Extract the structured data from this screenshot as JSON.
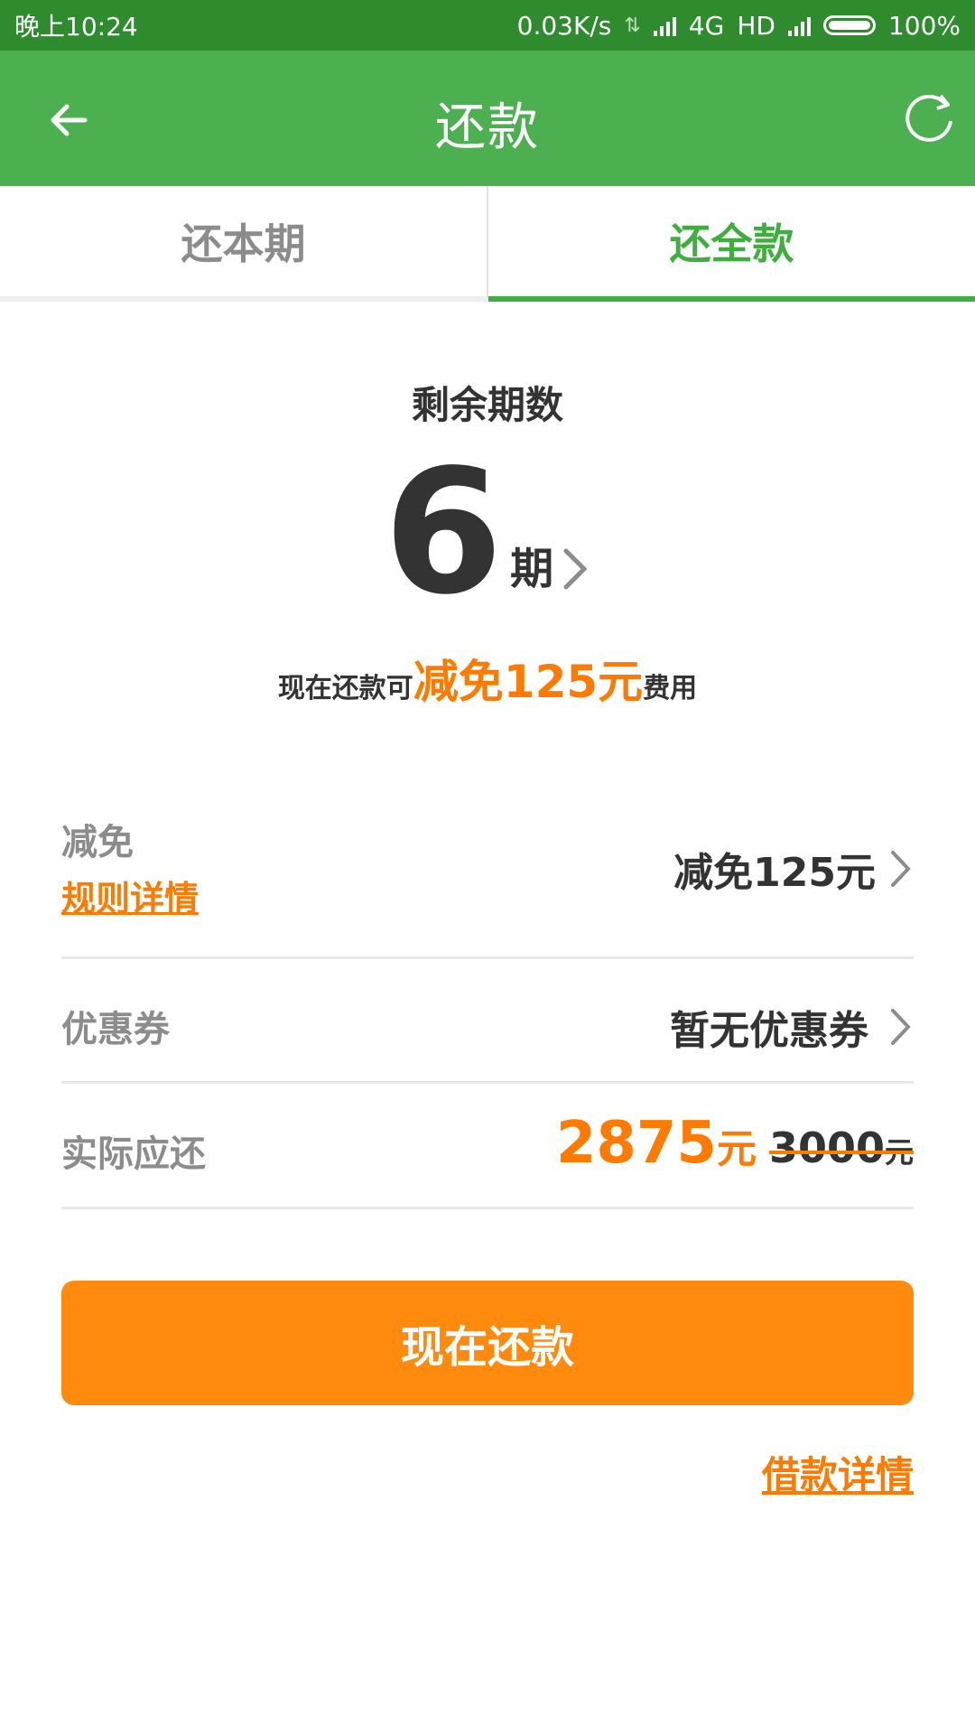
{
  "status_bar": {
    "time": "晚上10:24",
    "network_speed": "0.03K/s",
    "network_type": "4G",
    "hd_label": "HD",
    "battery": "100%"
  },
  "app_bar": {
    "title": "还款",
    "back_icon": "arrow-left",
    "refresh_icon": "refresh"
  },
  "tabs": [
    {
      "label": "还本期",
      "active": false
    },
    {
      "label": "还全款",
      "active": true
    }
  ],
  "summary": {
    "remaining_label": "剩余期数",
    "remaining_count": "6",
    "remaining_unit": "期",
    "discount_prefix": "现在还款可",
    "discount_highlight": "减免125元",
    "discount_suffix": "费用"
  },
  "rows": {
    "reduction": {
      "label": "减免",
      "link": "规则详情",
      "value": "减免125元"
    },
    "coupon": {
      "label": "优惠券",
      "value": "暂无优惠券"
    },
    "actual": {
      "label": "实际应还",
      "amount": "2875",
      "amount_unit": "元",
      "original_amount": "3000",
      "original_unit": "元"
    }
  },
  "actions": {
    "pay_now": "现在还款",
    "loan_detail": "借款详情"
  },
  "colors": {
    "status_bar": "#2e8b2e",
    "app_bar": "#4caf50",
    "accent_green": "#3fae3f",
    "accent_orange": "#ff7a00",
    "button_orange": "#ff8a0e"
  }
}
